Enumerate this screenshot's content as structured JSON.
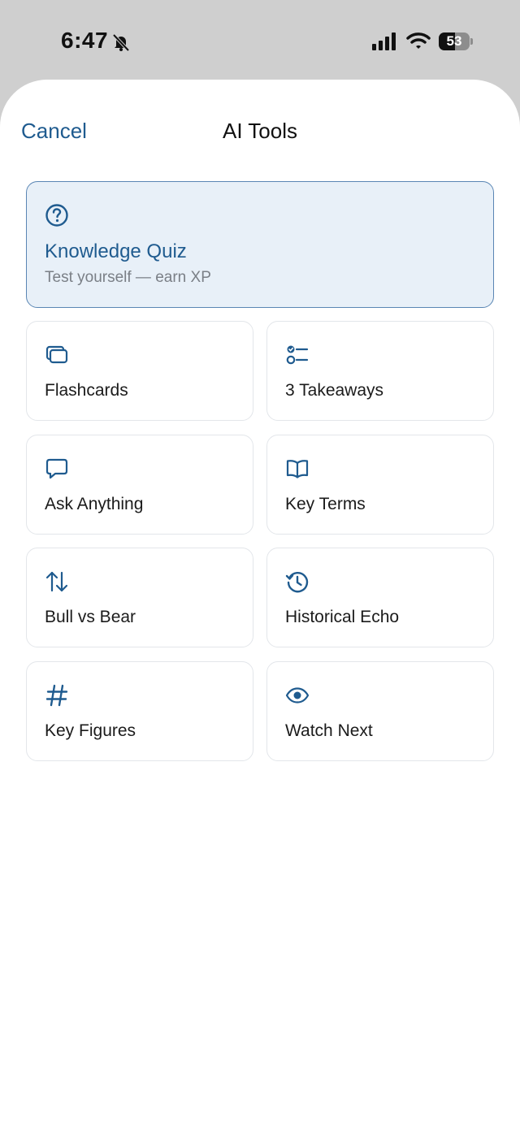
{
  "status_bar": {
    "time": "6:47",
    "battery_level": 53,
    "battery_text": "53"
  },
  "header": {
    "cancel_label": "Cancel",
    "title": "AI Tools"
  },
  "featured": {
    "icon": "question-circle-icon",
    "title": "Knowledge Quiz",
    "subtitle": "Test yourself — earn XP"
  },
  "tools": [
    {
      "icon": "flashcards-icon",
      "label": "Flashcards"
    },
    {
      "icon": "checklist-icon",
      "label": "3 Takeaways"
    },
    {
      "icon": "chat-bubble-icon",
      "label": "Ask Anything"
    },
    {
      "icon": "book-icon",
      "label": "Key Terms"
    },
    {
      "icon": "up-down-arrows-icon",
      "label": "Bull vs Bear"
    },
    {
      "icon": "history-icon",
      "label": "Historical Echo"
    },
    {
      "icon": "hashtag-icon",
      "label": "Key Figures"
    },
    {
      "icon": "eye-icon",
      "label": "Watch Next"
    }
  ],
  "colors": {
    "accent": "#1f5b8f",
    "featured_bg": "#e8f0f8"
  }
}
